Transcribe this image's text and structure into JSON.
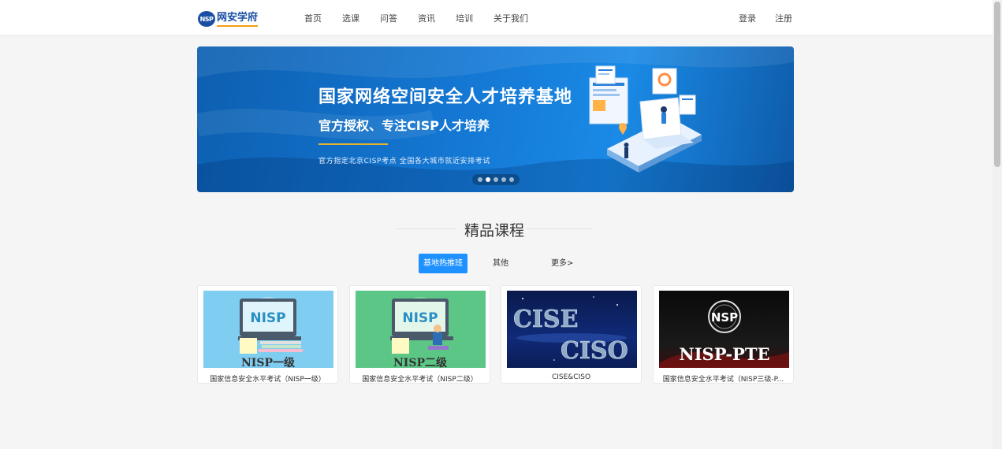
{
  "header": {
    "logo_mark": "NSP",
    "logo_text": "网安学府",
    "nav": [
      "首页",
      "选课",
      "问答",
      "资讯",
      "培训",
      "关于我们"
    ],
    "login": "登录",
    "register": "注册"
  },
  "banner": {
    "title": "国家网络空间安全人才培养基地",
    "subtitle": "官方授权、专注CISP人才培养",
    "note": "官方指定北京CISP考点  全国各大城市就近安排考试",
    "slide_count": 5,
    "active_slide": 2
  },
  "section": {
    "title": "精品课程",
    "tabs": [
      "基地热推班",
      "其他",
      "更多>"
    ]
  },
  "courses": [
    {
      "title": "国家信息安全水平考试（NISP一级）",
      "image_label": "NISP一级",
      "screen_label": "NISP"
    },
    {
      "title": "国家信息安全水平考试（NISP二级）",
      "image_label": "NISP二级",
      "screen_label": "NISP"
    },
    {
      "title": "CISE&CISO",
      "image_label_1": "CISE",
      "image_label_2": "CISO"
    },
    {
      "title": "国家信息安全水平考试（NISP三级-P...",
      "image_label": "NISP-PTE",
      "logo_label": "NSP"
    }
  ],
  "colors": {
    "accent": "#1e90ff",
    "brand": "#1a4fa3",
    "banner_gold": "#e6b22e"
  }
}
